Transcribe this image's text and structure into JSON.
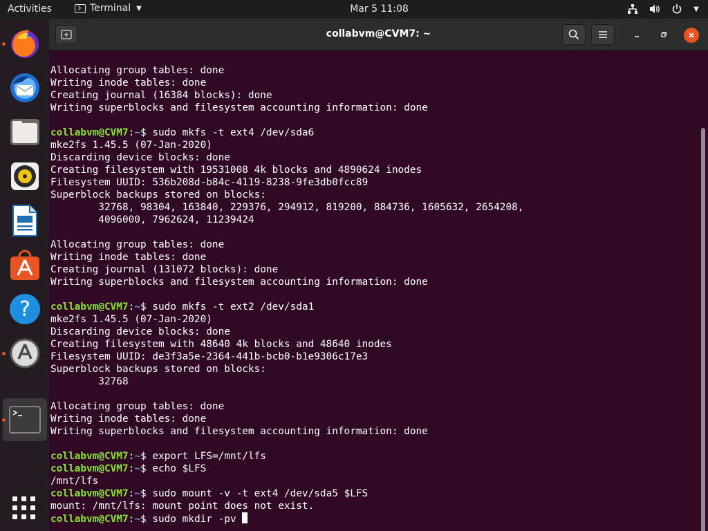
{
  "topbar": {
    "activities": "Activities",
    "app_menu_label": "Terminal",
    "clock": "Mar 5  11:08"
  },
  "dock": {
    "items": [
      "firefox",
      "thunderbird",
      "files",
      "rhythmbox",
      "libreoffice-writer",
      "ubuntu-software",
      "help",
      "software-updater",
      "terminal"
    ]
  },
  "window": {
    "title": "collabvm@CVM7: ~"
  },
  "terminal": {
    "lines": [
      {
        "text": "Allocating group tables: done"
      },
      {
        "text": "Writing inode tables: done"
      },
      {
        "text": "Creating journal (16384 blocks): done"
      },
      {
        "text": "Writing superblocks and filesystem accounting information: done"
      },
      {
        "text": ""
      },
      {
        "user": "collabvm@CVM7",
        "path": "~",
        "text": " sudo mkfs -t ext4 /dev/sda6"
      },
      {
        "text": "mke2fs 1.45.5 (07-Jan-2020)"
      },
      {
        "text": "Discarding device blocks: done"
      },
      {
        "text": "Creating filesystem with 19531008 4k blocks and 4890624 inodes"
      },
      {
        "text": "Filesystem UUID: 536b208d-b84c-4119-8238-9fe3db0fcc89"
      },
      {
        "text": "Superblock backups stored on blocks:"
      },
      {
        "text": "        32768, 98304, 163840, 229376, 294912, 819200, 884736, 1605632, 2654208,"
      },
      {
        "text": "        4096000, 7962624, 11239424"
      },
      {
        "text": ""
      },
      {
        "text": "Allocating group tables: done"
      },
      {
        "text": "Writing inode tables: done"
      },
      {
        "text": "Creating journal (131072 blocks): done"
      },
      {
        "text": "Writing superblocks and filesystem accounting information: done"
      },
      {
        "text": ""
      },
      {
        "user": "collabvm@CVM7",
        "path": "~",
        "text": " sudo mkfs -t ext2 /dev/sda1"
      },
      {
        "text": "mke2fs 1.45.5 (07-Jan-2020)"
      },
      {
        "text": "Discarding device blocks: done"
      },
      {
        "text": "Creating filesystem with 48640 4k blocks and 48640 inodes"
      },
      {
        "text": "Filesystem UUID: de3f3a5e-2364-441b-bcb0-b1e9306c17e3"
      },
      {
        "text": "Superblock backups stored on blocks:"
      },
      {
        "text": "        32768"
      },
      {
        "text": ""
      },
      {
        "text": "Allocating group tables: done"
      },
      {
        "text": "Writing inode tables: done"
      },
      {
        "text": "Writing superblocks and filesystem accounting information: done"
      },
      {
        "text": ""
      },
      {
        "user": "collabvm@CVM7",
        "path": "~",
        "text": " export LFS=/mnt/lfs"
      },
      {
        "user": "collabvm@CVM7",
        "path": "~",
        "text": " echo $LFS"
      },
      {
        "text": "/mnt/lfs"
      },
      {
        "user": "collabvm@CVM7",
        "path": "~",
        "text": " sudo mount -v -t ext4 /dev/sda5 $LFS"
      },
      {
        "text": "mount: /mnt/lfs: mount point does not exist."
      },
      {
        "user": "collabvm@CVM7",
        "path": "~",
        "text": " sudo mkdir -pv ",
        "cursor": true
      }
    ]
  }
}
